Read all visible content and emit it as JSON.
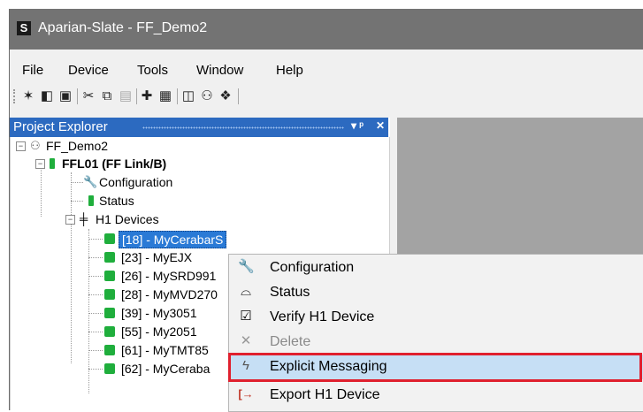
{
  "window": {
    "app_icon_letter": "S",
    "title": "Aparian-Slate  - FF_Demo2"
  },
  "menubar": {
    "items": [
      "File",
      "Device",
      "Tools",
      "Window",
      "Help"
    ]
  },
  "toolbar": {
    "buttons": [
      {
        "icon": "new-project-icon",
        "glyph": "✶"
      },
      {
        "icon": "open-icon",
        "glyph": "◧"
      },
      {
        "icon": "save-icon",
        "glyph": "▣"
      },
      {
        "icon": "cut-icon",
        "glyph": "✂"
      },
      {
        "icon": "copy-icon",
        "glyph": "⧉"
      },
      {
        "icon": "paste-icon",
        "glyph": "▤"
      },
      {
        "icon": "add-icon",
        "glyph": "✚"
      },
      {
        "icon": "properties-icon",
        "glyph": "▦"
      },
      {
        "icon": "verify-icon",
        "glyph": "◫"
      },
      {
        "icon": "users-icon",
        "glyph": "⚇"
      },
      {
        "icon": "network-icon",
        "glyph": "❖"
      }
    ]
  },
  "explorer": {
    "title": "Project Explorer",
    "pin_symbol": "▾ ᵖ",
    "close_symbol": "✕",
    "tree": {
      "root": "FF_Demo2",
      "device": "FFL01 (FF Link/B)",
      "configuration": "Configuration",
      "status": "Status",
      "h1_devices": "H1 Devices",
      "devices": [
        "[18] - MyCerabarS",
        "[23] - MyEJX",
        "[26] - MySRD991",
        "[28] - MyMVD270",
        "[39] - My3051",
        "[55] - My2051",
        "[61] - MyTMT85",
        "[62] - MyCeraba"
      ]
    }
  },
  "context_menu": {
    "items": [
      {
        "label": "Configuration",
        "icon": "wrench-icon",
        "glyph": "🔧",
        "enabled": true
      },
      {
        "label": "Status",
        "icon": "status-icon",
        "glyph": "⌓",
        "enabled": true
      },
      {
        "label": "Verify H1 Device",
        "icon": "checkbox-icon",
        "glyph": "☑",
        "enabled": true
      },
      {
        "label": "Delete",
        "icon": "delete-icon",
        "glyph": "✕",
        "enabled": false
      },
      {
        "label": "Explicit Messaging",
        "icon": "lightning-icon",
        "glyph": "ϟ",
        "enabled": true,
        "highlighted": true
      },
      {
        "label": "Export H1 Device",
        "icon": "export-icon",
        "glyph": "[→",
        "enabled": true
      }
    ]
  },
  "colors": {
    "titlebar": "#737373",
    "explorer_header": "#2c6ac0",
    "selection": "#2a7ad6",
    "status_green": "#1fae3c",
    "menu_highlight": "#c6dff5",
    "annotation_red": "#e0202e"
  }
}
